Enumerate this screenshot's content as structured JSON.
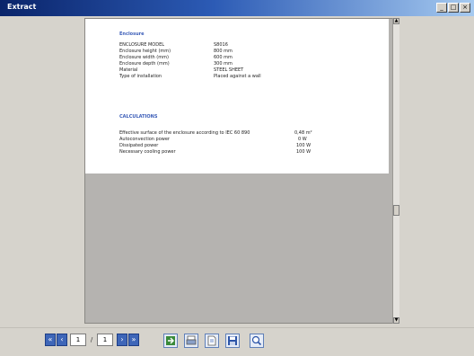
{
  "window": {
    "title": "Extract",
    "controls": [
      "_",
      "□",
      "×"
    ]
  },
  "enclosure": {
    "title": "Enclosure",
    "rows": [
      {
        "label": "ENCLOSURE MODEL",
        "value": "S8016"
      },
      {
        "label": "Enclosure height (mm)",
        "value": "800 mm"
      },
      {
        "label": "Enclosure width (mm)",
        "value": "600 mm"
      },
      {
        "label": "Enclosure depth (mm)",
        "value": "300 mm"
      },
      {
        "label": "Material",
        "value": "STEEL SHEET"
      },
      {
        "label": "Type of installation",
        "value": "Placed against a wall"
      }
    ]
  },
  "calculations": {
    "title": "CALCULATIONS",
    "rows": [
      {
        "label": "Effective surface of the enclosure according to IEC 60 890",
        "value": "0,48 m²"
      },
      {
        "label": "Autoconvection power",
        "value": "0 W"
      },
      {
        "label": "Dissipated power",
        "value": "100 W"
      },
      {
        "label": "Necessary cooling power",
        "value": "100 W"
      }
    ]
  },
  "toolbar": {
    "first": "«",
    "prev": "‹",
    "page_current": "1",
    "page_separator": "/",
    "page_total": "1",
    "next": "›",
    "last": "»",
    "tools": [
      "export-icon",
      "print-icon",
      "page-setup-icon",
      "save-icon",
      "zoom-icon"
    ]
  }
}
